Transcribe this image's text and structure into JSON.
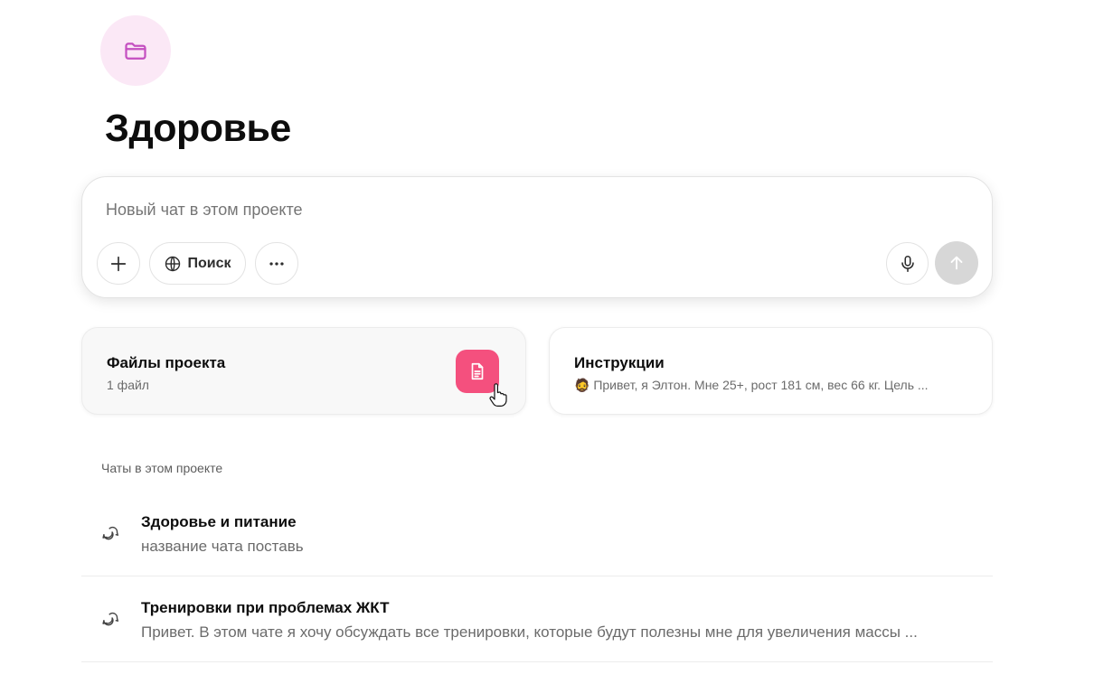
{
  "project": {
    "icon": "folder-icon",
    "title": "Здоровье"
  },
  "composer": {
    "placeholder": "Новый чат в этом проекте",
    "search_label": "Поиск",
    "icons": [
      "plus-icon",
      "globe-icon",
      "more-icon",
      "microphone-icon",
      "arrow-up-icon"
    ]
  },
  "cards": {
    "files": {
      "title": "Файлы проекта",
      "subtitle": "1 файл",
      "icon": "document-icon"
    },
    "instructions": {
      "title": "Инструкции",
      "emoji": "🧔",
      "subtitle": "Привет, я Элтон. Мне 25+, рост 181 см, вес 66 кг. Цель ..."
    }
  },
  "chats": {
    "section_label": "Чаты в этом проекте",
    "items": [
      {
        "title": "Здоровье и питание",
        "preview": "название чата поставь"
      },
      {
        "title": "Тренировки при проблемах ЖКТ",
        "preview": "Привет. В этом чате я хочу обсуждать все тренировки, которые будут полезны мне для увеличения массы ..."
      }
    ]
  },
  "colors": {
    "accent_pink": "#f4507e",
    "project_icon_bg": "#fbe8f6",
    "project_icon_stroke": "#c44fc0",
    "send_disabled": "#d7d7d7"
  }
}
